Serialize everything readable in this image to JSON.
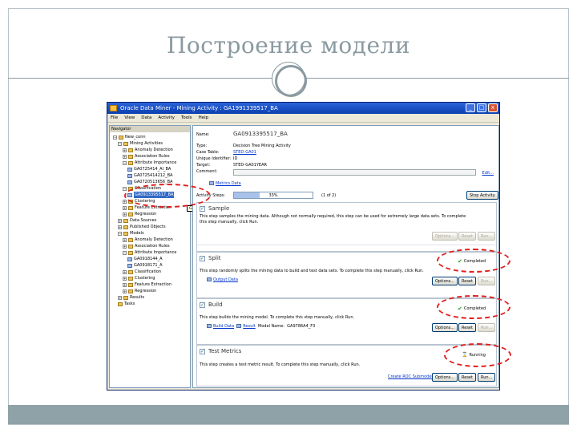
{
  "slide": {
    "title": "Построение модели"
  },
  "colors": {
    "accent_grey": "#8a9aa0",
    "ring_red": "#e02020",
    "titlebar_blue": "#0b3fb0",
    "completed_green": "#1ea01e"
  },
  "window": {
    "title": "Oracle Data Miner - Mining Activity : GA1991339517_BA",
    "buttons": [
      "_",
      "□",
      "x"
    ],
    "menu": [
      "File",
      "View",
      "Data",
      "Activity",
      "Tools",
      "Help"
    ]
  },
  "navigator": {
    "header": "Navigator",
    "items": [
      {
        "label": "New_conn",
        "box": "−",
        "icon": "folder"
      },
      {
        "label": "Mining Activities",
        "box": "−",
        "icon": "folder"
      },
      {
        "label": "Anomaly Detection",
        "box": "+",
        "icon": "folder"
      },
      {
        "label": "Association Rules",
        "box": "+",
        "icon": "folder"
      },
      {
        "label": "Attribute Importance",
        "box": "−",
        "icon": "folder"
      },
      {
        "label": "GA0725414_AI_BA",
        "box": "",
        "icon": "activity"
      },
      {
        "label": "GA0725414212_BA",
        "box": "",
        "icon": "activity"
      },
      {
        "label": "GA0720513656_BA",
        "box": "",
        "icon": "activity"
      },
      {
        "label": "Classification",
        "box": "−",
        "icon": "folder"
      },
      {
        "label": "GA0913395517_BA",
        "box": "",
        "icon": "activity",
        "selected": true
      },
      {
        "label": "Clustering",
        "box": "+",
        "icon": "folder"
      },
      {
        "label": "Feature Extraction",
        "box": "+",
        "icon": "folder"
      },
      {
        "label": "Regression",
        "box": "+",
        "icon": "folder"
      },
      {
        "label": "Data Sources",
        "box": "+",
        "icon": "folder"
      },
      {
        "label": "Published Objects",
        "box": "+",
        "icon": "folder"
      },
      {
        "label": "Models",
        "box": "−",
        "icon": "folder"
      },
      {
        "label": "Anomaly Detection",
        "box": "+",
        "icon": "folder"
      },
      {
        "label": "Association Rules",
        "box": "+",
        "icon": "folder"
      },
      {
        "label": "Attribute Importance",
        "box": "−",
        "icon": "folder"
      },
      {
        "label": "GA0918144_A",
        "box": "",
        "icon": "activity"
      },
      {
        "label": "GA0918171_A",
        "box": "",
        "icon": "activity"
      },
      {
        "label": "Classification",
        "box": "+",
        "icon": "folder"
      },
      {
        "label": "Clustering",
        "box": "+",
        "icon": "folder"
      },
      {
        "label": "Feature Extraction",
        "box": "+",
        "icon": "folder"
      },
      {
        "label": "Regression",
        "box": "+",
        "icon": "folder"
      },
      {
        "label": "Results",
        "box": "+",
        "icon": "folder"
      },
      {
        "label": "Tasks",
        "box": "",
        "icon": "folder"
      }
    ],
    "tooltip": "GA0913395517_BA"
  },
  "activity": {
    "name_label": "Name:",
    "name_value": "GA0913395517_BA",
    "type_label": "Type:",
    "type_value": "Decision Tree Mining Activity",
    "case_table_label": "Case Table:",
    "case_table_value": "STED-GA01",
    "unique_id_label": "Unique Identifier:",
    "unique_id_value": "ID",
    "target_label": "Target:",
    "target_value": "STED-GA01YEAR",
    "comment_label": "Comment:",
    "edit_link": "Edit...",
    "metrics_link": "Metrics Data",
    "steps_label": "Activity Steps:",
    "progress_percent": 33,
    "progress_text": "33%",
    "progress_of": "(1 of 2)",
    "stop_button": "Stop Activity"
  },
  "steps": [
    {
      "title": "Sample",
      "checked": true,
      "desc_lines": [
        "This step samples the mining data. Although not normally required, this step can be used for extremely large data sets. To complete",
        "this step manually, click Run."
      ],
      "status": "",
      "links": [],
      "buttons": [
        {
          "label": "Options...",
          "enabled": false
        },
        {
          "label": "Reset",
          "enabled": false
        },
        {
          "label": "Run...",
          "enabled": false
        }
      ]
    },
    {
      "title": "Split",
      "checked": true,
      "desc_lines": [
        "This step randomly splits the mining data to build and test data sets. To complete this step manually, click Run."
      ],
      "status": "Completed",
      "links": [
        "Output Data"
      ],
      "buttons": [
        {
          "label": "Options...",
          "enabled": true
        },
        {
          "label": "Reset",
          "enabled": true
        },
        {
          "label": "Run...",
          "enabled": false
        }
      ]
    },
    {
      "title": "Build",
      "checked": true,
      "desc_lines": [
        "This step builds the mining model. To complete this step manually, click Run."
      ],
      "status": "Completed",
      "links": [
        "Build Data",
        "Result",
        "Model Name:",
        "GA9786A4_F3"
      ],
      "buttons": [
        {
          "label": "Options...",
          "enabled": true
        },
        {
          "label": "Reset",
          "enabled": true
        },
        {
          "label": "Run...",
          "enabled": false
        }
      ]
    },
    {
      "title": "Test Metrics",
      "checked": true,
      "desc_lines": [
        "This step creates a test metric result. To complete this step manually, click Run."
      ],
      "status": "Running",
      "links": [
        "Create ROC Submodel"
      ],
      "buttons": [
        {
          "label": "Options...",
          "enabled": true
        },
        {
          "label": "Reset",
          "enabled": true
        },
        {
          "label": "Run...",
          "enabled": true
        }
      ]
    }
  ]
}
